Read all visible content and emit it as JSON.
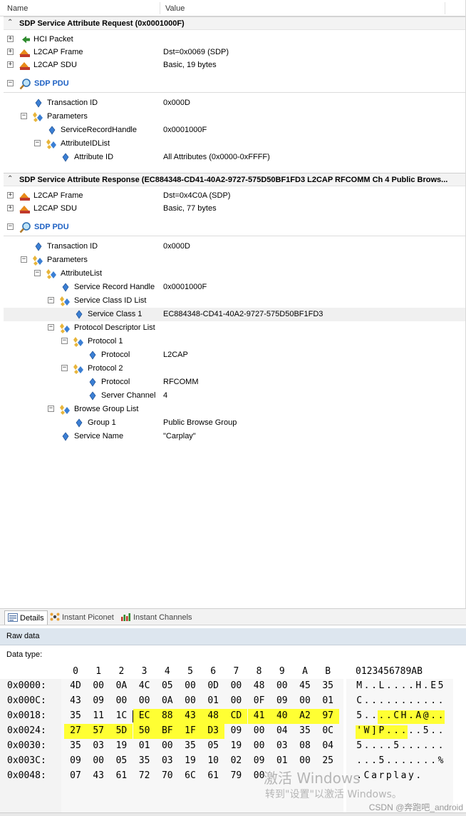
{
  "columns": {
    "name": "Name",
    "value": "Value"
  },
  "request": {
    "title": "SDP Service Attribute Request (0x0001000F)",
    "rows": [
      {
        "label": "HCI Packet",
        "value": ""
      },
      {
        "label": "L2CAP Frame",
        "value": "Dst=0x0069 (SDP)"
      },
      {
        "label": "L2CAP SDU",
        "value": "Basic, 19 bytes"
      },
      {
        "label": "SDP PDU",
        "value": ""
      },
      {
        "label": "Transaction ID",
        "value": "0x000D"
      },
      {
        "label": "Parameters",
        "value": ""
      },
      {
        "label": "ServiceRecordHandle",
        "value": "0x0001000F"
      },
      {
        "label": "AttributeIDList",
        "value": ""
      },
      {
        "label": "Attribute ID",
        "value": "All Attributes (0x0000-0xFFFF)"
      }
    ]
  },
  "response": {
    "title": "SDP Service Attribute Response (EC884348-CD41-40A2-9727-575D50BF1FD3 L2CAP RFCOMM Ch 4 Public Brows...",
    "rows": [
      {
        "label": "L2CAP Frame",
        "value": "Dst=0x4C0A (SDP)"
      },
      {
        "label": "L2CAP SDU",
        "value": "Basic, 77 bytes"
      },
      {
        "label": "SDP PDU",
        "value": ""
      },
      {
        "label": "Transaction ID",
        "value": "0x000D"
      },
      {
        "label": "Parameters",
        "value": ""
      },
      {
        "label": "AttributeList",
        "value": ""
      },
      {
        "label": "Service Record Handle",
        "value": "0x0001000F"
      },
      {
        "label": "Service Class ID List",
        "value": ""
      },
      {
        "label": "Service Class 1",
        "value": "EC884348-CD41-40A2-9727-575D50BF1FD3"
      },
      {
        "label": "Protocol Descriptor List",
        "value": ""
      },
      {
        "label": "Protocol 1",
        "value": ""
      },
      {
        "label": "Protocol",
        "value": "L2CAP"
      },
      {
        "label": "Protocol 2",
        "value": ""
      },
      {
        "label": "Protocol",
        "value": "RFCOMM"
      },
      {
        "label": "Server Channel",
        "value": "4"
      },
      {
        "label": "Browse Group List",
        "value": ""
      },
      {
        "label": "Group 1",
        "value": "Public Browse Group"
      },
      {
        "label": "Service Name",
        "value": "\"Carplay\""
      }
    ]
  },
  "tabs": [
    {
      "label": "Details",
      "active": true
    },
    {
      "label": "Instant Piconet",
      "active": false
    },
    {
      "label": "Instant Channels",
      "active": false
    }
  ],
  "raw_data": {
    "header": "Raw data",
    "data_type_label": "Data type:",
    "column_headers": [
      "0",
      "1",
      "2",
      "3",
      "4",
      "5",
      "6",
      "7",
      "8",
      "9",
      "A",
      "B"
    ],
    "ascii_header": "0123456789AB",
    "highlight_color": "#ffff33",
    "rows": [
      {
        "addr": "0x0000:",
        "bytes": [
          "4D",
          "00",
          "0A",
          "4C",
          "05",
          "00",
          "0D",
          "00",
          "48",
          "00",
          "45",
          "35"
        ],
        "ascii": "M..L....H.E5",
        "hl": []
      },
      {
        "addr": "0x000C:",
        "bytes": [
          "43",
          "09",
          "00",
          "00",
          "0A",
          "00",
          "01",
          "00",
          "0F",
          "09",
          "00",
          "01"
        ],
        "ascii": "C...........",
        "hl": []
      },
      {
        "addr": "0x0018:",
        "bytes": [
          "35",
          "11",
          "1C",
          "EC",
          "88",
          "43",
          "48",
          "CD",
          "41",
          "40",
          "A2",
          "97"
        ],
        "ascii": "5....CH.A@..",
        "hl": [
          3,
          4,
          5,
          6,
          7,
          8,
          9,
          10,
          11
        ]
      },
      {
        "addr": "0x0024:",
        "bytes": [
          "27",
          "57",
          "5D",
          "50",
          "BF",
          "1F",
          "D3",
          "09",
          "00",
          "04",
          "35",
          "0C"
        ],
        "ascii": "'W]P.....5..",
        "hl": [
          0,
          1,
          2,
          3,
          4,
          5,
          6
        ]
      },
      {
        "addr": "0x0030:",
        "bytes": [
          "35",
          "03",
          "19",
          "01",
          "00",
          "35",
          "05",
          "19",
          "00",
          "03",
          "08",
          "04"
        ],
        "ascii": "5....5......",
        "hl": []
      },
      {
        "addr": "0x003C:",
        "bytes": [
          "09",
          "00",
          "05",
          "35",
          "03",
          "19",
          "10",
          "02",
          "09",
          "01",
          "00",
          "25"
        ],
        "ascii": "...5.......%",
        "hl": []
      },
      {
        "addr": "0x0048:",
        "bytes": [
          "07",
          "43",
          "61",
          "72",
          "70",
          "6C",
          "61",
          "79",
          "00",
          "",
          "",
          ""
        ],
        "ascii": ".Carplay.",
        "hl": []
      }
    ]
  },
  "watermark": {
    "line1": "激活 Windows",
    "line2": "转到\"设置\"以激活 Windows。",
    "credit": "CSDN @奔跑吧_android"
  }
}
